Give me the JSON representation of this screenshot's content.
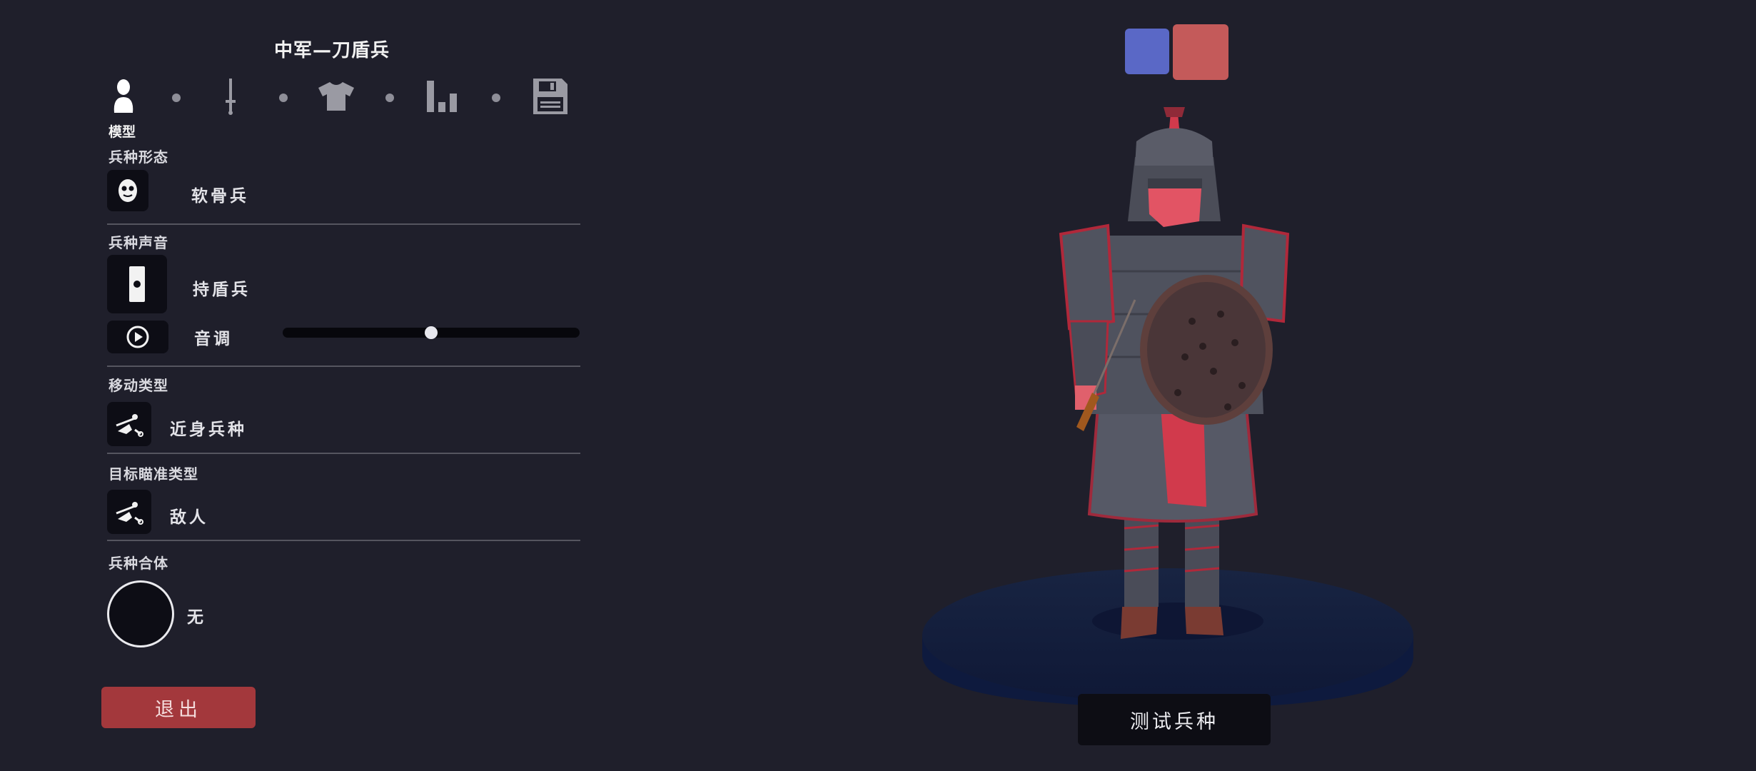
{
  "header": {
    "title": "中军—刀盾兵"
  },
  "tabs": [
    {
      "label": "模型",
      "icon": "person-icon",
      "active": true
    },
    {
      "label": "",
      "icon": "sword-icon",
      "active": false
    },
    {
      "label": "",
      "icon": "shirt-icon",
      "active": false
    },
    {
      "label": "",
      "icon": "bar-chart-icon",
      "active": false
    },
    {
      "label": "",
      "icon": "save-icon",
      "active": false
    }
  ],
  "sections": {
    "form": {
      "heading": "兵种形态",
      "value": "软骨兵",
      "icon": "mask-icon"
    },
    "voice": {
      "heading": "兵种声音",
      "value": "持盾兵",
      "icon": "shield-voice-icon",
      "pitch_label": "音调",
      "pitch_value": 0.5,
      "play_icon": "play-icon"
    },
    "movement": {
      "heading": "移动类型",
      "value": "近身兵种",
      "icon": "melee-icon"
    },
    "targeting": {
      "heading": "目标瞄准类型",
      "value": "敌人",
      "icon": "target-icon"
    },
    "combine": {
      "heading": "兵种合体",
      "value": "无"
    }
  },
  "buttons": {
    "exit": "退出",
    "test": "测试兵种"
  },
  "team_colors": {
    "blue": "#5a68c6",
    "red": "#c45a5a"
  },
  "colors": {
    "background": "#1f1f2b",
    "accent_red": "#a3383c",
    "panel_dark": "#0d0d15"
  }
}
